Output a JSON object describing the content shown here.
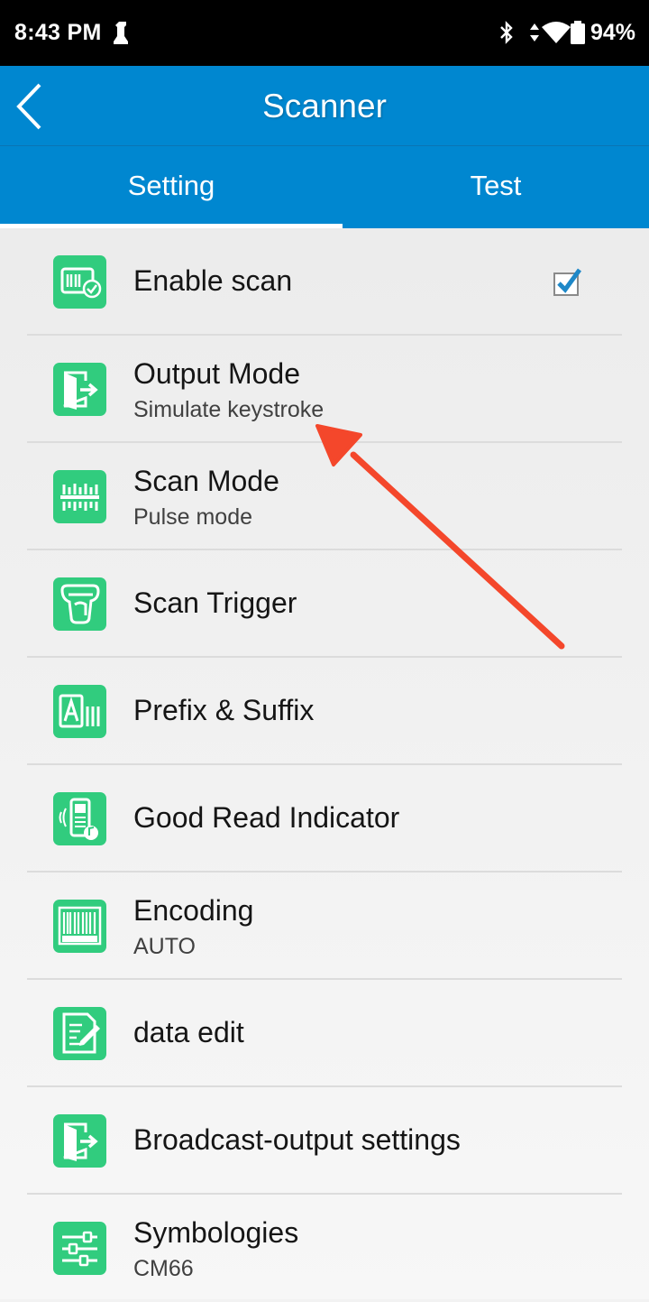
{
  "status_bar": {
    "time": "8:43 PM",
    "battery": "94%"
  },
  "app_bar": {
    "title": "Scanner",
    "back_icon": "chevron-left-icon"
  },
  "tabs": [
    {
      "label": "Setting",
      "selected": true
    },
    {
      "label": "Test",
      "selected": false
    }
  ],
  "settings": [
    {
      "label": "Enable scan",
      "subtitle": "",
      "icon": "barcode-check-icon",
      "checked": true
    },
    {
      "label": "Output Mode",
      "subtitle": "Simulate keystroke",
      "icon": "output-door-icon"
    },
    {
      "label": "Scan Mode",
      "subtitle": "Pulse mode",
      "icon": "scan-lines-icon"
    },
    {
      "label": "Scan Trigger",
      "subtitle": "",
      "icon": "scan-trigger-hand-icon"
    },
    {
      "label": "Prefix & Suffix",
      "subtitle": "",
      "icon": "prefix-suffix-icon"
    },
    {
      "label": "Good Read Indicator",
      "subtitle": "",
      "icon": "phone-vibrate-sound-icon"
    },
    {
      "label": "Encoding",
      "subtitle": "AUTO",
      "icon": "barcode-number-icon"
    },
    {
      "label": "data edit",
      "subtitle": "",
      "icon": "document-edit-icon"
    },
    {
      "label": "Broadcast-output settings",
      "subtitle": "",
      "icon": "output-door-icon"
    },
    {
      "label": "Symbologies",
      "subtitle": "CM66",
      "icon": "sliders-icon"
    }
  ],
  "colors": {
    "app_bar": "#0087d0",
    "icon_green": "#31cc7e",
    "checkbox_blue": "#1e88c8",
    "annotation_arrow": "#f4472b"
  }
}
